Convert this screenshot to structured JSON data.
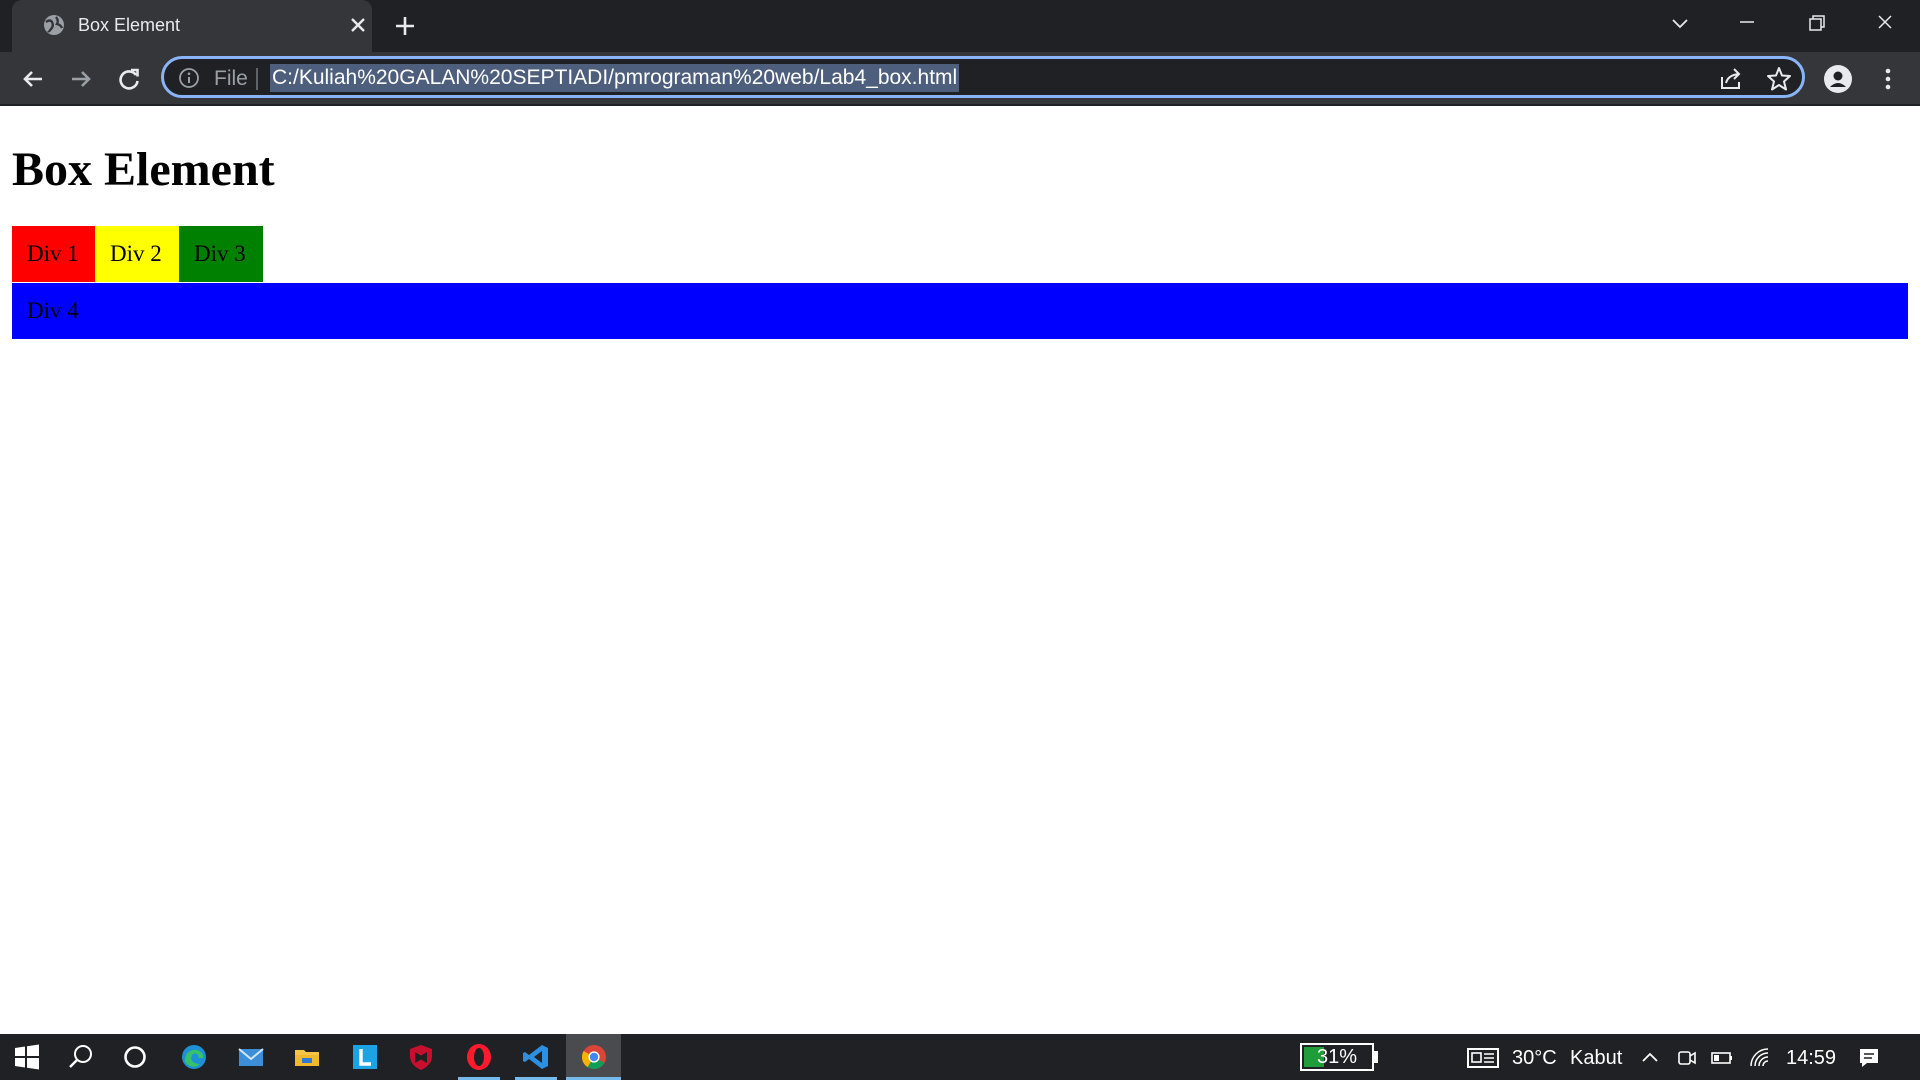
{
  "browser": {
    "tab": {
      "title": "Box Element"
    },
    "omnibox": {
      "scheme_label": "File",
      "url": "C:/Kuliah%20GALAN%20SEPTIADI/pmrograman%20web/Lab4_box.html"
    }
  },
  "page": {
    "heading": "Box Element",
    "boxes": [
      {
        "label": "Div 1",
        "color": "#ff0000"
      },
      {
        "label": "Div 2",
        "color": "#ffff00"
      },
      {
        "label": "Div 3",
        "color": "#008000"
      },
      {
        "label": "Div 4",
        "color": "#0000ff"
      }
    ]
  },
  "taskbar": {
    "battery": "31%",
    "weather": "30°C",
    "weather_desc": "Kabut",
    "clock": "14:59",
    "pinned": [
      "windows-start-icon",
      "search-icon",
      "cortana-icon",
      "edge-icon",
      "mail-icon",
      "file-explorer-icon",
      "l-app-icon",
      "mcafee-icon",
      "opera-icon",
      "vscode-icon",
      "chrome-icon"
    ]
  }
}
